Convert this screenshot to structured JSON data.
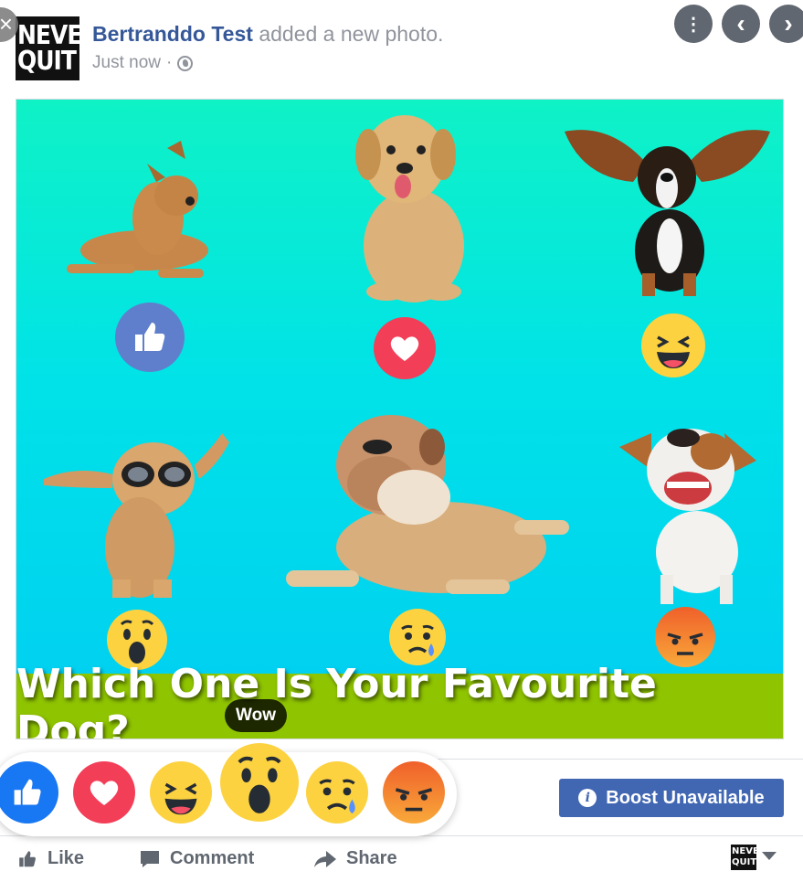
{
  "post": {
    "avatar_lines": [
      "NEVER",
      "QUIT"
    ],
    "author": "Bertranddo Test",
    "action_text": " added a new photo.",
    "time": "Just now",
    "dot": "·"
  },
  "photo": {
    "banner_text": "Which One Is Your Favourite Dog?"
  },
  "reactions": [
    {
      "name": "Like",
      "color": "#1877f2"
    },
    {
      "name": "Love",
      "color": "#f33e58"
    },
    {
      "name": "Haha",
      "color": "#f7b125"
    },
    {
      "name": "Wow",
      "color": "#f7b125"
    },
    {
      "name": "Sad",
      "color": "#f7b125"
    },
    {
      "name": "Angry",
      "color": "#e9710f"
    }
  ],
  "tooltip": "Wow",
  "boost_label": "Boost Unavailable",
  "actions": {
    "like": "Like",
    "comment": "Comment",
    "share": "Share"
  },
  "icons": {
    "close": "×",
    "more": "⋮",
    "prev": "‹",
    "next": "›"
  }
}
